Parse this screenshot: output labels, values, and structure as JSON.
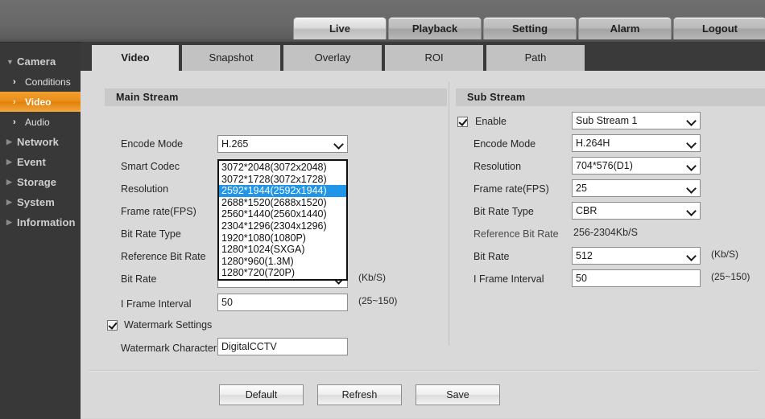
{
  "header": {
    "nav": [
      {
        "label": "Live",
        "active": true
      },
      {
        "label": "Playback",
        "active": false
      },
      {
        "label": "Setting",
        "active": false
      },
      {
        "label": "Alarm",
        "active": false
      },
      {
        "label": "Logout",
        "active": false
      }
    ]
  },
  "sidebar": {
    "groups": [
      {
        "label": "Camera",
        "icon": "triangle-down-icon"
      },
      {
        "label": "Network",
        "icon": "triangle-right-icon"
      },
      {
        "label": "Event",
        "icon": "triangle-right-icon"
      },
      {
        "label": "Storage",
        "icon": "triangle-right-icon"
      },
      {
        "label": "System",
        "icon": "triangle-right-icon"
      },
      {
        "label": "Information",
        "icon": "triangle-right-icon"
      }
    ],
    "camera_children": [
      {
        "label": "Conditions",
        "active": false
      },
      {
        "label": "Video",
        "active": true
      },
      {
        "label": "Audio",
        "active": false
      }
    ],
    "accent_color": "#e8890d"
  },
  "tabs": [
    {
      "label": "Video",
      "active": true
    },
    {
      "label": "Snapshot",
      "active": false
    },
    {
      "label": "Overlay",
      "active": false
    },
    {
      "label": "ROI",
      "active": false
    },
    {
      "label": "Path",
      "active": false
    }
  ],
  "main_stream": {
    "title": "Main Stream",
    "encode_mode": {
      "label": "Encode Mode",
      "value": "H.265"
    },
    "smart_codec": {
      "label": "Smart Codec"
    },
    "resolution": {
      "label": "Resolution"
    },
    "frame_rate": {
      "label": "Frame rate(FPS)"
    },
    "bit_rate_type": {
      "label": "Bit Rate Type"
    },
    "reference_bit_rate": {
      "label": "Reference Bit Rate"
    },
    "bit_rate": {
      "label": "Bit Rate",
      "unit": "(Kb/S)"
    },
    "i_frame_interval": {
      "label": "I Frame Interval",
      "value": "50",
      "unit": "(25~150)"
    },
    "watermark_settings": {
      "label": "Watermark Settings",
      "checked": true
    },
    "watermark_character": {
      "label": "Watermark Character",
      "value": "DigitalCCTV"
    }
  },
  "resolution_dropdown": {
    "open": true,
    "selected": "2592*1944(2592x1944)",
    "highlight_color": "#2196e8",
    "options": [
      "3072*2048(3072x2048)",
      "3072*1728(3072x1728)",
      "2592*1944(2592x1944)",
      "2688*1520(2688x1520)",
      "2560*1440(2560x1440)",
      "2304*1296(2304x1296)",
      "1920*1080(1080P)",
      "1280*1024(SXGA)",
      "1280*960(1.3M)",
      "1280*720(720P)"
    ]
  },
  "sub_stream": {
    "title": "Sub Stream",
    "enable": {
      "label": "Enable",
      "checked": true,
      "value": "Sub Stream 1"
    },
    "encode_mode": {
      "label": "Encode Mode",
      "value": "H.264H"
    },
    "resolution": {
      "label": "Resolution",
      "value": "704*576(D1)"
    },
    "frame_rate": {
      "label": "Frame rate(FPS)",
      "value": "25"
    },
    "bit_rate_type": {
      "label": "Bit Rate Type",
      "value": "CBR"
    },
    "reference_bit_rate": {
      "label": "Reference Bit Rate",
      "value": "256-2304Kb/S"
    },
    "bit_rate": {
      "label": "Bit Rate",
      "value": "512",
      "unit": "(Kb/S)"
    },
    "i_frame_interval": {
      "label": "I Frame Interval",
      "value": "50",
      "unit": "(25~150)"
    }
  },
  "footer": {
    "buttons": [
      {
        "label": "Default"
      },
      {
        "label": "Refresh"
      },
      {
        "label": "Save"
      }
    ]
  }
}
